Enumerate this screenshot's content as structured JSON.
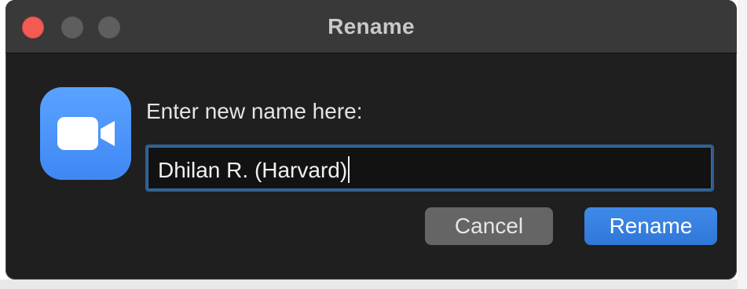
{
  "window": {
    "title": "Rename"
  },
  "dialog": {
    "app_icon": "zoom-video-camera-icon",
    "prompt_label": "Enter new name here:",
    "name_input_value": "Dhilan R. (Harvard)",
    "cancel_label": "Cancel",
    "rename_label": "Rename"
  },
  "colors": {
    "window_background": "#201f1f",
    "titlebar_background": "#393939",
    "close_button": "#f25a52",
    "inactive_traffic_light": "#5e5e5e",
    "app_icon_blue": "#4b93fa",
    "input_focus_border": "#2f5f91",
    "primary_button": "#3580e0",
    "secondary_button": "#656565"
  }
}
